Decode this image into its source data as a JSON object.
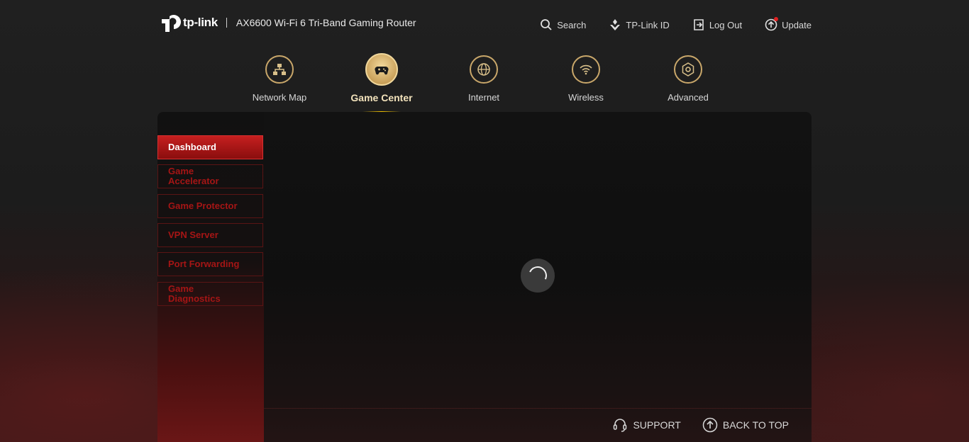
{
  "header": {
    "brand": "tp-link",
    "model": "AX6600 Wi-Fi 6 Tri-Band Gaming Router",
    "actions": [
      {
        "label": "Search",
        "icon": "search-icon"
      },
      {
        "label": "TP-Link ID",
        "icon": "tplink-id-icon"
      },
      {
        "label": "Log Out",
        "icon": "logout-icon"
      },
      {
        "label": "Update",
        "icon": "update-icon"
      }
    ]
  },
  "nav": {
    "items": [
      {
        "label": "Network Map",
        "icon": "network-map-icon"
      },
      {
        "label": "Game Center",
        "icon": "gamepad-icon",
        "active": true
      },
      {
        "label": "Internet",
        "icon": "globe-icon"
      },
      {
        "label": "Wireless",
        "icon": "wifi-icon"
      },
      {
        "label": "Advanced",
        "icon": "gear-icon"
      }
    ]
  },
  "sidebar": {
    "items": [
      {
        "label": "Dashboard",
        "active": true
      },
      {
        "label": "Game Accelerator"
      },
      {
        "label": "Game Protector"
      },
      {
        "label": "VPN Server"
      },
      {
        "label": "Port Forwarding"
      },
      {
        "label": "Game Diagnostics"
      }
    ]
  },
  "footer": {
    "support": "SUPPORT",
    "back_to_top": "BACK TO TOP"
  },
  "colors": {
    "accent_red": "#c61f1f",
    "gold": "#c9a76a",
    "active_underline": "#f0c000"
  }
}
